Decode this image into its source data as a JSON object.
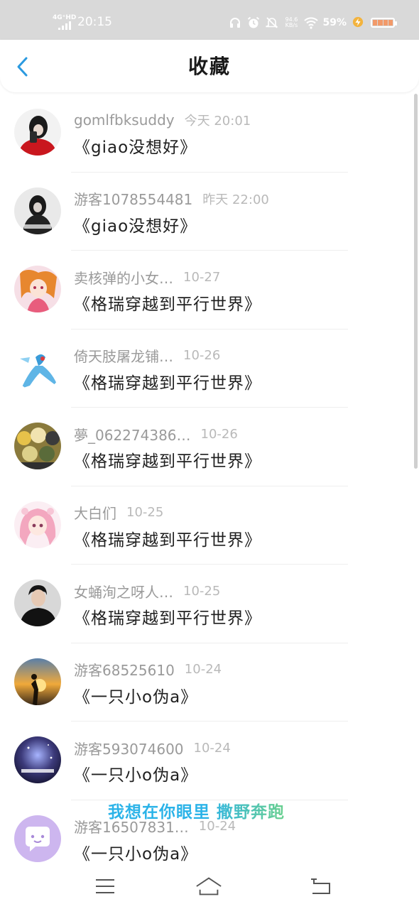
{
  "status_bar": {
    "network": "4G⁺HD",
    "time": "20:15",
    "net_speed_top": "94.6",
    "net_speed_bottom": "KB/s",
    "battery_percent": "59%"
  },
  "header": {
    "title": "收藏"
  },
  "colors": {
    "accent": "#2b9ae0",
    "overlay_start": "#2bb3e8",
    "overlay_end": "#6ad08e"
  },
  "favorites": [
    {
      "name": "gomlfbksuddy",
      "date": "今天 20:01",
      "work": "《giao没想好》",
      "avatar": "avatar-red-shirt"
    },
    {
      "name": "游客1078554481",
      "date": "昨天 22:00",
      "work": "《giao没想好》",
      "avatar": "avatar-dark-figure"
    },
    {
      "name": "卖核弹的小女…",
      "date": "10-27",
      "work": "《格瑞穿越到平行世界》",
      "avatar": "avatar-anime-girl"
    },
    {
      "name": "倚天肢屠龙铺…",
      "date": "10-26",
      "work": "《格瑞穿越到平行世界》",
      "avatar": "avatar-blue-pokemon"
    },
    {
      "name": "夢_062274386…",
      "date": "10-26",
      "work": "《格瑞穿越到平行世界》",
      "avatar": "avatar-anime-group"
    },
    {
      "name": "大白们",
      "date": "10-25",
      "work": "《格瑞穿越到平行世界》",
      "avatar": "avatar-pink-hair"
    },
    {
      "name": "女蛹洵之呀人…",
      "date": "10-25",
      "work": "《格瑞穿越到平行世界》",
      "avatar": "avatar-man-black"
    },
    {
      "name": "游客68525610",
      "date": "10-24",
      "work": "《一只小o伪a》",
      "avatar": "avatar-sunset"
    },
    {
      "name": "游客593074600",
      "date": "10-24",
      "work": "《一只小o伪a》",
      "avatar": "avatar-galaxy"
    },
    {
      "name": "游客16507831…",
      "date": "10-24",
      "work": "《一只小o伪a》",
      "avatar": "avatar-default-chat"
    }
  ],
  "overlay_text": "我想在你眼里 撒野奔跑",
  "navbar": {
    "menu_icon": "menu-icon",
    "home_icon": "home-icon",
    "back_icon": "back-nav-icon"
  }
}
